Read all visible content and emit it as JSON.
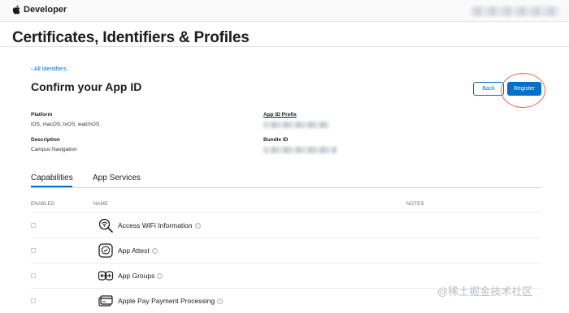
{
  "header": {
    "brand": "Developer",
    "page_title": "Certificates, Identifiers & Profiles"
  },
  "confirm": {
    "back_link": "‹ All Identifiers",
    "title": "Confirm your App ID",
    "back_button": "Back",
    "register_button": "Register",
    "platform_label": "Platform",
    "platform_value": "iOS, macOS, tvOS, watchOS",
    "description_label": "Description",
    "description_value": "Campus Navigation",
    "app_id_prefix_label": "App ID Prefix",
    "bundle_id_label": "Bundle ID"
  },
  "tabs": [
    {
      "label": "Capabilities",
      "active": true
    },
    {
      "label": "App Services",
      "active": false
    }
  ],
  "columns": {
    "enabled": "ENABLED",
    "name": "NAME",
    "notes": "NOTES"
  },
  "capabilities": [
    {
      "name": "Access WiFi Information",
      "icon": "wifi-search-icon",
      "enabled": false
    },
    {
      "name": "App Attest",
      "icon": "app-attest-icon",
      "enabled": false
    },
    {
      "name": "App Groups",
      "icon": "app-groups-icon",
      "enabled": false
    },
    {
      "name": "Apple Pay Payment Processing",
      "icon": "apple-pay-icon",
      "enabled": false
    }
  ],
  "watermark": "@稀土掘金技术社区",
  "colors": {
    "accent": "#0070c9",
    "highlight": "#e96b4b"
  }
}
